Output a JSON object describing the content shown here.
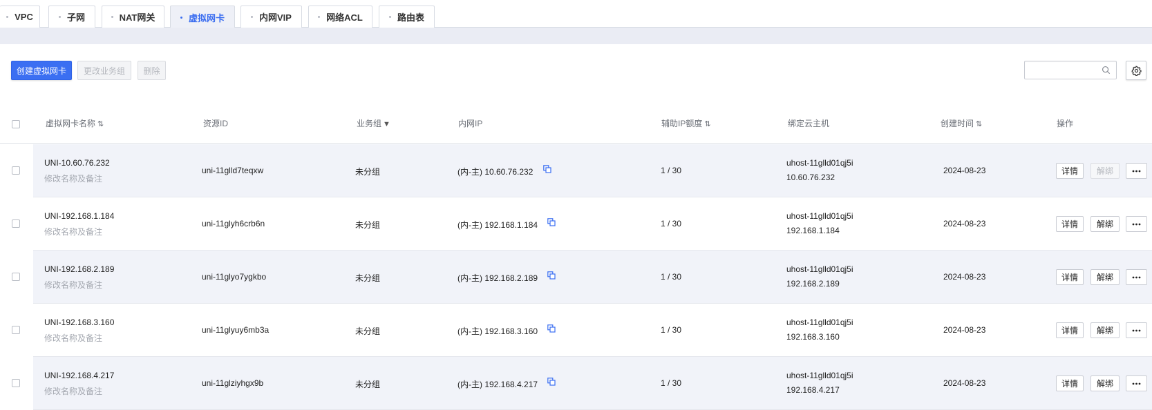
{
  "tabs": [
    {
      "label": "VPC",
      "active": false
    },
    {
      "label": "子网",
      "active": false
    },
    {
      "label": "NAT网关",
      "active": false
    },
    {
      "label": "虚拟网卡",
      "active": true
    },
    {
      "label": "内网VIP",
      "active": false
    },
    {
      "label": "网络ACL",
      "active": false
    },
    {
      "label": "路由表",
      "active": false
    }
  ],
  "toolbar": {
    "create_label": "创建虚拟网卡",
    "change_group_label": "更改业务组",
    "delete_label": "删除",
    "search_placeholder": ""
  },
  "table": {
    "headers": {
      "name": "虚拟网卡名称",
      "resource_id": "资源ID",
      "group": "业务组",
      "private_ip": "内网IP",
      "secondary_quota": "辅助IP额度",
      "bound_host": "绑定云主机",
      "created": "创建时间",
      "actions": "操作"
    },
    "rows": [
      {
        "name": "UNI-10.60.76.232",
        "note": "修改名称及备注",
        "resource_id": "uni-11glld7teqxw",
        "group": "未分组",
        "ip": "(内-主) 10.60.76.232",
        "quota": "1 / 30",
        "host": "uhost-11glld01qj5i",
        "host_ip": "10.60.76.232",
        "created": "2024-08-23",
        "detail": "详情",
        "unbind": "解绑",
        "unbind_disabled": true
      },
      {
        "name": "UNI-192.168.1.184",
        "note": "修改名称及备注",
        "resource_id": "uni-11glyh6crb6n",
        "group": "未分组",
        "ip": "(内-主) 192.168.1.184",
        "quota": "1 / 30",
        "host": "uhost-11glld01qj5i",
        "host_ip": "192.168.1.184",
        "created": "2024-08-23",
        "detail": "详情",
        "unbind": "解绑",
        "unbind_disabled": false
      },
      {
        "name": "UNI-192.168.2.189",
        "note": "修改名称及备注",
        "resource_id": "uni-11glyo7ygkbo",
        "group": "未分组",
        "ip": "(内-主) 192.168.2.189",
        "quota": "1 / 30",
        "host": "uhost-11glld01qj5i",
        "host_ip": "192.168.2.189",
        "created": "2024-08-23",
        "detail": "详情",
        "unbind": "解绑",
        "unbind_disabled": false
      },
      {
        "name": "UNI-192.168.3.160",
        "note": "修改名称及备注",
        "resource_id": "uni-11glyuy6mb3a",
        "group": "未分组",
        "ip": "(内-主) 192.168.3.160",
        "quota": "1 / 30",
        "host": "uhost-11glld01qj5i",
        "host_ip": "192.168.3.160",
        "created": "2024-08-23",
        "detail": "详情",
        "unbind": "解绑",
        "unbind_disabled": false
      },
      {
        "name": "UNI-192.168.4.217",
        "note": "修改名称及备注",
        "resource_id": "uni-11glziyhgx9b",
        "group": "未分组",
        "ip": "(内-主) 192.168.4.217",
        "quota": "1 / 30",
        "host": "uhost-11glld01qj5i",
        "host_ip": "192.168.4.217",
        "created": "2024-08-23",
        "detail": "详情",
        "unbind": "解绑",
        "unbind_disabled": false
      }
    ]
  },
  "colors": {
    "accent": "#3b6ff2",
    "row_alt": "#f1f3f9",
    "band": "#eaecf4"
  },
  "icons": {
    "search": "search-icon",
    "settings": "gear-icon",
    "copy": "copy-icon",
    "more": "more-icon",
    "sort": "sort-icon",
    "filter": "filter-icon"
  }
}
